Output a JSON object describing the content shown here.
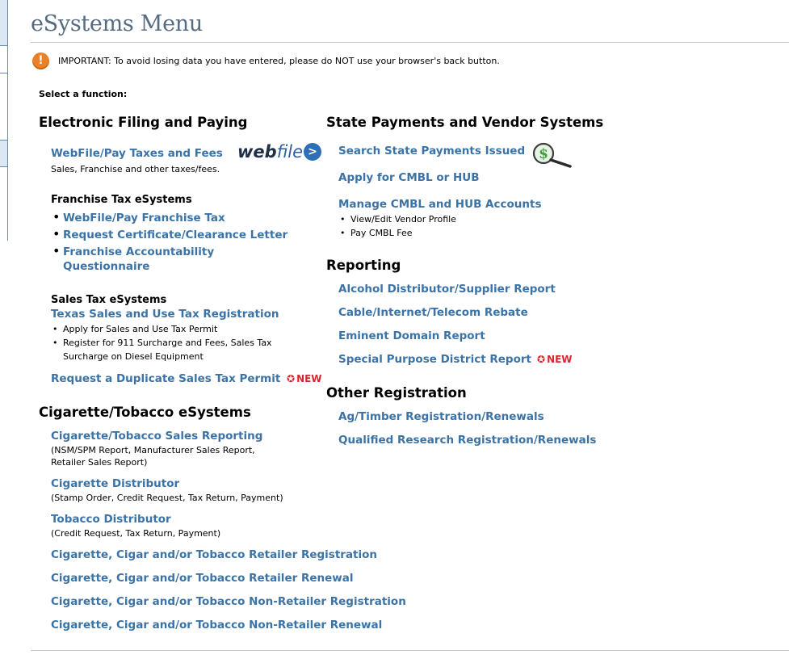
{
  "page": {
    "title": "eSystems Menu"
  },
  "notice": {
    "icon": "exclamation-icon",
    "text": "IMPORTANT:  To avoid losing data you have entered, please do NOT use your browser's back button."
  },
  "select_label": "Select a function:",
  "left": {
    "efiling": {
      "heading": "Electronic Filing and Paying",
      "webfile_link": "WebFile/Pay Taxes and Fees",
      "webfile_desc": "Sales, Franchise and other taxes/fees.",
      "logo": {
        "bold": "web",
        "rest": "file",
        "arrow": ">"
      }
    },
    "franchise": {
      "heading": "Franchise Tax eSystems",
      "links": [
        "WebFile/Pay Franchise Tax",
        "Request Certificate/Clearance Letter",
        "Franchise Accountability",
        "Questionnaire"
      ]
    },
    "sales": {
      "heading": "Sales Tax eSystems",
      "registration_link": "Texas Sales and Use Tax Registration",
      "bullets": [
        "Apply for Sales and Use Tax Permit",
        "Register for 911 Surcharge and Fees, Sales Tax",
        "Surcharge on Diesel Equipment"
      ],
      "duplicate_link": "Request a Duplicate Sales Tax Permit",
      "new_badge": "NEW"
    },
    "cigarette": {
      "heading": "Cigarette/Tobacco eSystems",
      "sales_reporting_link": "Cigarette/Tobacco Sales Reporting",
      "sales_reporting_desc": [
        "(NSM/SPM Report, Manufacturer Sales Report,",
        "Retailer Sales Report)"
      ],
      "distributor_link": "Cigarette Distributor",
      "distributor_desc": "(Stamp Order, Credit Request, Tax Return, Payment)",
      "tobacco_link": "Tobacco Distributor",
      "tobacco_desc": "(Credit Request, Tax Return, Payment)",
      "retail_links": [
        "Cigarette, Cigar and/or Tobacco Retailer Registration",
        "Cigarette, Cigar and/or Tobacco Retailer Renewal",
        "Cigarette, Cigar and/or Tobacco Non-Retailer Registration",
        "Cigarette, Cigar and/or Tobacco Non-Retailer Renewal"
      ]
    }
  },
  "right": {
    "state": {
      "heading": "State Payments and Vendor Systems",
      "search_link": "Search State Payments Issued",
      "cmbl_link": "Apply for CMBL or HUB",
      "manage_link": "Manage CMBL and HUB Accounts",
      "manage_bullets": [
        "View/Edit Vendor Profile",
        "Pay CMBL Fee"
      ]
    },
    "reporting": {
      "heading": "Reporting",
      "links": [
        "Alcohol Distributor/Supplier Report",
        "Cable/Internet/Telecom Rebate",
        "Eminent Domain Report",
        "Special Purpose District Report"
      ],
      "new_badge": "NEW"
    },
    "other": {
      "heading": "Other Registration",
      "links": [
        "Ag/Timber Registration/Renewals",
        "Qualified Research Registration/Renewals"
      ]
    }
  },
  "colors": {
    "link": "#3b73a7",
    "title": "#546b82",
    "new": "#d9262e",
    "warning": "#e8812a"
  }
}
